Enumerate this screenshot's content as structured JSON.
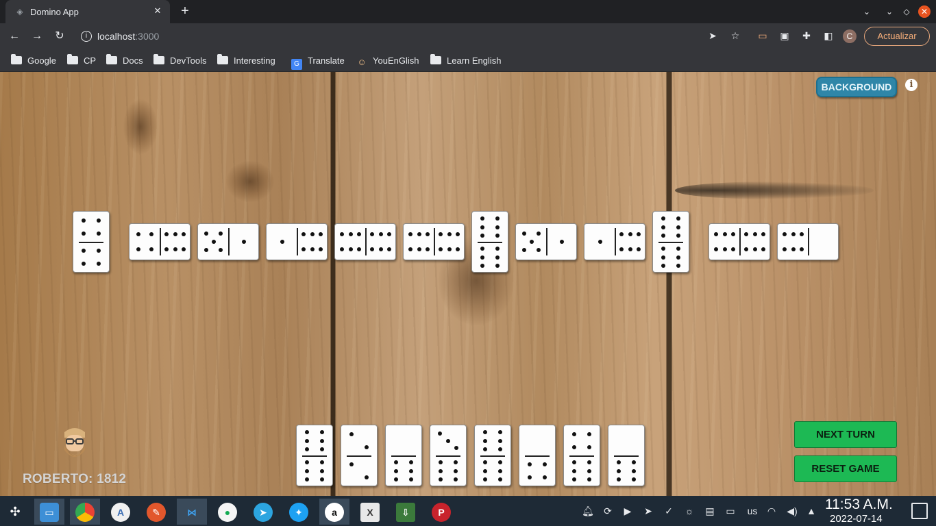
{
  "browser": {
    "tab_title": "Domino App",
    "tab_close": "✕",
    "new_tab": "+",
    "url_host": "localhost",
    "url_port": ":3000",
    "profile_initial": "C",
    "update_label": "Actualizar"
  },
  "bookmarks": [
    {
      "label": "Google",
      "icon": "folder-icon"
    },
    {
      "label": "CP",
      "icon": "folder-icon"
    },
    {
      "label": "Docs",
      "icon": "folder-icon"
    },
    {
      "label": "DevTools",
      "icon": "folder-icon"
    },
    {
      "label": "Interesting",
      "icon": "folder-icon"
    },
    {
      "label": "Translate",
      "icon": "translate-icon"
    },
    {
      "label": "YouEnGlish",
      "icon": "youenglish-icon"
    },
    {
      "label": "Learn English",
      "icon": "folder-icon"
    }
  ],
  "game": {
    "background_label": "BACKGROUND",
    "info_label": "i",
    "player_label": "ROBERTO: 1812",
    "next_turn_label": "NEXT TURN",
    "reset_game_label": "RESET GAME",
    "board": [
      {
        "a": 4,
        "b": 4,
        "vertical": true
      },
      {
        "a": 4,
        "b": 6,
        "vertical": false
      },
      {
        "a": 5,
        "b": 1,
        "vertical": false
      },
      {
        "a": 1,
        "b": 6,
        "vertical": false
      },
      {
        "a": 6,
        "b": 6,
        "vertical": false
      },
      {
        "a": 6,
        "b": 6,
        "vertical": false
      },
      {
        "a": 6,
        "b": 6,
        "vertical": true
      },
      {
        "a": 5,
        "b": 1,
        "vertical": false
      },
      {
        "a": 1,
        "b": 6,
        "vertical": false
      },
      {
        "a": 6,
        "b": 6,
        "vertical": true
      },
      {
        "a": 6,
        "b": 6,
        "vertical": false
      },
      {
        "a": 6,
        "b": 0,
        "vertical": false
      }
    ],
    "hand": [
      {
        "a": 6,
        "b": 6
      },
      {
        "a": 2,
        "b": 2
      },
      {
        "a": 0,
        "b": 6
      },
      {
        "a": 3,
        "b": 6
      },
      {
        "a": 6,
        "b": 6
      },
      {
        "a": 0,
        "b": 4
      },
      {
        "a": 4,
        "b": 6
      },
      {
        "a": 0,
        "b": 6
      }
    ]
  },
  "taskbar": {
    "apps": [
      "launcher-icon",
      "files-icon",
      "chrome-icon",
      "android-studio-icon",
      "inkscape-icon",
      "vscode-icon",
      "mongodb-compass-icon",
      "telegram-icon",
      "twitter-icon",
      "anydesk-icon",
      "xournal-icon",
      "downloader-icon",
      "pinterest-icon"
    ],
    "keyboard_layout": "us",
    "time": "11:53 A.M.",
    "date": "2022-07-14"
  }
}
